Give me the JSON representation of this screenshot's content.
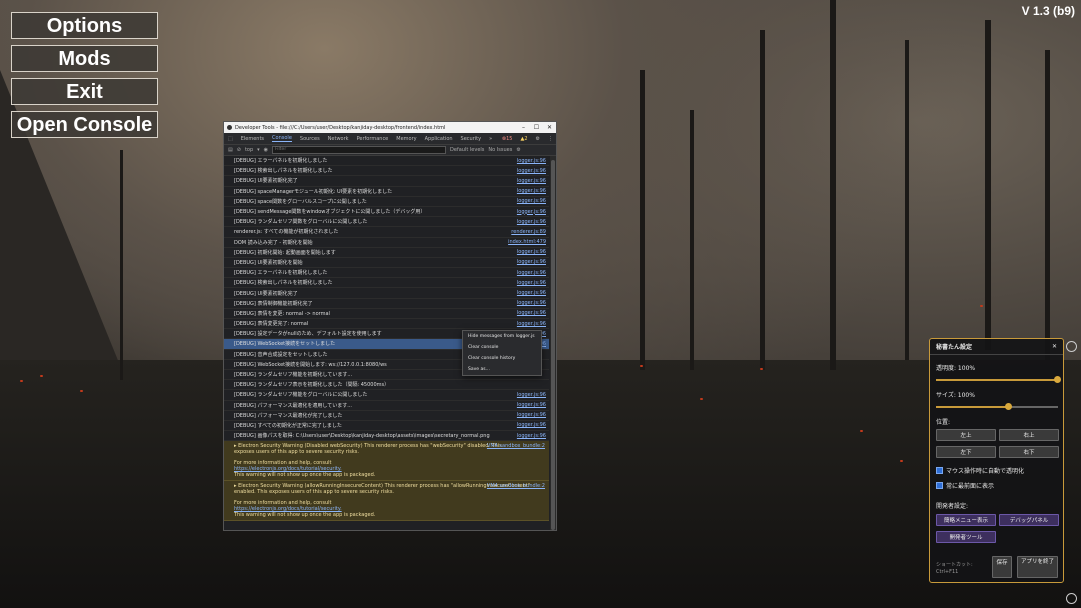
{
  "version": "V 1.3 (b9)",
  "menu": {
    "options": "Options",
    "mods": "Mods",
    "exit": "Exit",
    "open_console": "Open Console"
  },
  "devtools": {
    "title": "Developer Tools - file:///C:/Users/user/Desktop/kanjiday-desktop/frontend/index.html",
    "tabs": [
      "Elements",
      "Console",
      "Sources",
      "Network",
      "Performance",
      "Memory",
      "Application",
      "Security"
    ],
    "active_tab": "Console",
    "errors": "15",
    "warnings": "2",
    "context": "top",
    "filter_placeholder": "Filter",
    "levels": "Default levels",
    "issues": "No Issues",
    "logs": [
      {
        "m": "[DEBUG] エラーパネルを初期化しました",
        "s": "logger.js:96"
      },
      {
        "m": "[DEBUG] 検索出しパネルを初期化しました",
        "s": "logger.js:96"
      },
      {
        "m": "[DEBUG] UI要素初期化完了",
        "s": "logger.js:96"
      },
      {
        "m": "[DEBUG] spaceManagerモジュール初期化: UI要素を初期化しました",
        "s": "logger.js:96"
      },
      {
        "m": "[DEBUG] space関数をグローバルスコープに公開しました",
        "s": "logger.js:96"
      },
      {
        "m": "[DEBUG] sendMessage関数をwindowオブジェクトに公開しました（デバッグ用）",
        "s": "logger.js:96"
      },
      {
        "m": "[DEBUG] ランダムセリフ関数をグローバルに公開しました",
        "s": "logger.js:96"
      },
      {
        "m": "renderer.js: すべての機能が初期化されました",
        "s": "renderer.js:89"
      },
      {
        "m": "DOM 読み込み完了 - 初期化を開始",
        "s": "index.html:479"
      },
      {
        "m": "[DEBUG] 初期化開始: 起動画面を開始します",
        "s": "logger.js:96"
      },
      {
        "m": "[DEBUG] UI要素初期化を開始",
        "s": "logger.js:96"
      },
      {
        "m": "[DEBUG] エラーパネルを初期化しました",
        "s": "logger.js:96"
      },
      {
        "m": "[DEBUG] 検索出しパネルを初期化しました",
        "s": "logger.js:96"
      },
      {
        "m": "[DEBUG] UI要素初期化完了",
        "s": "logger.js:96"
      },
      {
        "m": "[DEBUG] 表情制御機能初期化完了",
        "s": "logger.js:96"
      },
      {
        "m": "[DEBUG] 表情を変更: normal -> normal",
        "s": "logger.js:96"
      },
      {
        "m": "[DEBUG] 表情変更完了: normal",
        "s": "logger.js:96"
      },
      {
        "m": "[DEBUG] 設定データがnullのため、デフォルト設定を使用します",
        "s": "logger.js:96"
      },
      {
        "m": "[DEBUG] WebSocket接続をセットしました",
        "s": "logger.js:96",
        "sel": true
      },
      {
        "m": "[DEBUG] 音声合成設定をセットしました",
        "s": ""
      },
      {
        "m": "[DEBUG] WebSocket接続を開始します: ws://127.0.0.1:8080/ws",
        "s": ""
      },
      {
        "m": "[DEBUG] ランダムセリフ機能を初期化しています...",
        "s": ""
      },
      {
        "m": "[DEBUG] ランダムセリフ表示を初期化しました（間隔: 45000ms）",
        "s": ""
      },
      {
        "m": "[DEBUG] ランダムセリフ機能をグローバルに公開しました",
        "s": "logger.js:96"
      },
      {
        "m": "[DEBUG] パフォーマンス最適化を適用しています...",
        "s": "logger.js:96"
      },
      {
        "m": "[DEBUG] パフォーマンス最適化が完了しました",
        "s": "logger.js:96"
      },
      {
        "m": "[DEBUG] すべての初期化が正常に完了しました",
        "s": "logger.js:96"
      },
      {
        "m": "[DEBUG] 画像パスを取得: C:\\Users\\user\\Desktop\\kanjiday-desktop\\assets\\images\\secretary_normal.png",
        "s": "logger.js:96"
      }
    ],
    "warn1": {
      "head": "▸ Electron Security Warning (Disabled webSecurity) This renderer process has \"webSecurity\" disabled. This",
      "body": "exposes users of this app to severe security risks.",
      "more": "For more information and help, consult",
      "link": "https://electronjs.org/docs/tutorial/security.",
      "tail": "This warning will not show up once the app is packaged.",
      "src": "VM4 sandbox_bundle:2"
    },
    "warn2": {
      "head": "▸ Electron Security Warning (allowRunningInsecureContent) This renderer process has \"allowRunningInsecureContent\"",
      "body": "enabled. This exposes users of this app to severe security risks.",
      "more": "For more information and help, consult",
      "link": "https://electronjs.org/docs/tutorial/security.",
      "tail": "This warning will not show up once the app is packaged.",
      "src": "VM4 sandbox_bundle:2"
    },
    "context_menu": [
      "Hide messages from logger.js",
      "Clear console",
      "Clear console history",
      "Save as..."
    ]
  },
  "panel": {
    "title": "秘書たん設定",
    "opacity_label": "透明度: 100%",
    "opacity_value": 1.0,
    "size_label": "サイズ: 100%",
    "size_value": 0.6,
    "position_label": "位置:",
    "pos_buttons": [
      "左上",
      "右上",
      "左下",
      "右下"
    ],
    "check1": "マウス操作時に自動で透明化",
    "check2": "常に最前面に表示",
    "dev_label": "開発者設定:",
    "dev_buttons": [
      "簡略メニュー表示",
      "デバッグパネル",
      "開発者ツール"
    ],
    "shortcut": "ショートカット:",
    "shortcut_key": "Ctrl+F11",
    "save": "保存",
    "quit": "アプリを終了"
  }
}
